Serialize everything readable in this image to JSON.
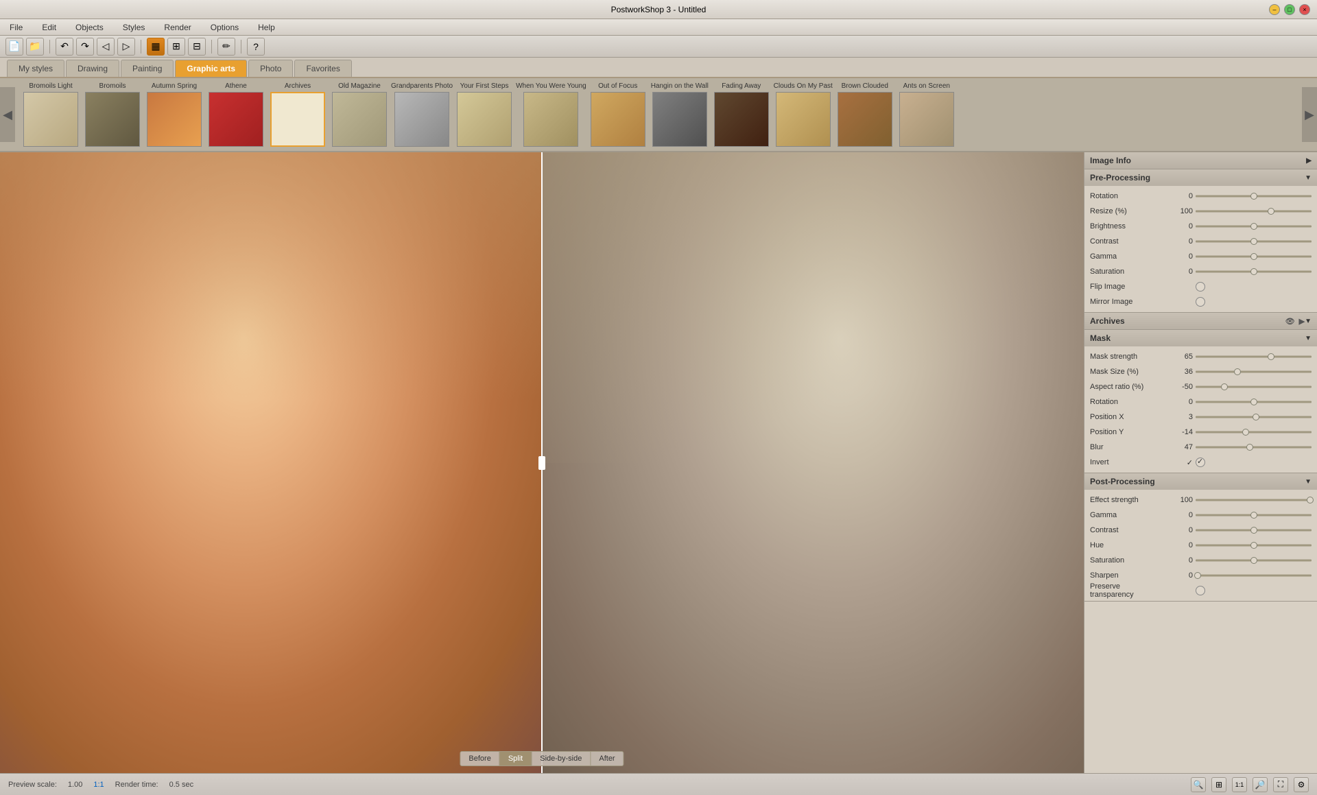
{
  "titlebar": {
    "title": "PostworkShop 3 - Untitled"
  },
  "menubar": {
    "items": [
      "File",
      "Edit",
      "Objects",
      "Styles",
      "Render",
      "Options",
      "Help"
    ]
  },
  "toolbar": {
    "buttons": [
      "new",
      "open",
      "undo",
      "redo",
      "history-back",
      "history-forward",
      "select-rect",
      "select-multi",
      "style1",
      "style2",
      "style3",
      "brush",
      "help"
    ]
  },
  "style_tabs": {
    "items": [
      "My styles",
      "Drawing",
      "Painting",
      "Graphic arts",
      "Photo",
      "Favorites"
    ],
    "active": "Graphic arts"
  },
  "thumbnails": {
    "items": [
      {
        "label": "Bromoils Light",
        "style": "bromoils-light",
        "active": false
      },
      {
        "label": "Bromoils",
        "style": "bromoils",
        "active": false
      },
      {
        "label": "Autumn Spring",
        "style": "autumn",
        "active": false
      },
      {
        "label": "Athene",
        "style": "athene",
        "active": false
      },
      {
        "label": "Archives",
        "style": "archives",
        "active": true
      },
      {
        "label": "Old Magazine",
        "style": "old-magazine",
        "active": false
      },
      {
        "label": "Grandparents Photo",
        "style": "grandparents",
        "active": false
      },
      {
        "label": "Your First Steps",
        "style": "first-steps",
        "active": false
      },
      {
        "label": "When You Were Young",
        "style": "when-young",
        "active": false
      },
      {
        "label": "Out of Focus",
        "style": "out-of-focus",
        "active": false
      },
      {
        "label": "Hangin on the Wall",
        "style": "hangin",
        "active": false
      },
      {
        "label": "Fading Away",
        "style": "fading",
        "active": false
      },
      {
        "label": "Clouds On My Past",
        "style": "clouds",
        "active": false
      },
      {
        "label": "Brown Clouded",
        "style": "brown",
        "active": false
      },
      {
        "label": "Ants on Screen",
        "style": "ants",
        "active": false
      }
    ]
  },
  "view_buttons": {
    "items": [
      "Before",
      "Split",
      "Side-by-side",
      "After"
    ],
    "active": "Split"
  },
  "panels": {
    "image_info": {
      "label": "Image Info",
      "collapsed": false
    },
    "pre_processing": {
      "label": "Pre-Processing",
      "collapsed": false,
      "params": [
        {
          "label": "Rotation",
          "value": "0",
          "percent": 50
        },
        {
          "label": "Resize (%)",
          "value": "100",
          "percent": 65
        },
        {
          "label": "Brightness",
          "value": "0",
          "percent": 50
        },
        {
          "label": "Contrast",
          "value": "0",
          "percent": 50
        },
        {
          "label": "Gamma",
          "value": "0",
          "percent": 50
        },
        {
          "label": "Saturation",
          "value": "0",
          "percent": 50
        },
        {
          "label": "Flip Image",
          "value": "",
          "type": "checkbox",
          "checked": false
        },
        {
          "label": "Mirror Image",
          "value": "",
          "type": "checkbox",
          "checked": false
        }
      ]
    },
    "archives": {
      "label": "Archives",
      "collapsed": false
    },
    "mask": {
      "label": "Mask",
      "collapsed": false,
      "params": [
        {
          "label": "Mask strength",
          "value": "65",
          "percent": 65
        },
        {
          "label": "Mask Size (%)",
          "value": "36",
          "percent": 36
        },
        {
          "label": "Aspect ratio (%)",
          "value": "-50",
          "percent": 25
        },
        {
          "label": "Rotation",
          "value": "0",
          "percent": 50
        },
        {
          "label": "Position X",
          "value": "3",
          "percent": 52
        },
        {
          "label": "Position Y",
          "value": "-14",
          "percent": 43
        },
        {
          "label": "Blur",
          "value": "47",
          "percent": 47
        },
        {
          "label": "Invert",
          "value": "✓",
          "type": "checkbox",
          "checked": true
        }
      ]
    },
    "post_processing": {
      "label": "Post-Processing",
      "collapsed": false,
      "params": [
        {
          "label": "Effect strength",
          "value": "100",
          "percent": 100
        },
        {
          "label": "Gamma",
          "value": "0",
          "percent": 50
        },
        {
          "label": "Contrast",
          "value": "0",
          "percent": 50
        },
        {
          "label": "Hue",
          "value": "0",
          "percent": 50
        },
        {
          "label": "Saturation",
          "value": "0",
          "percent": 50
        },
        {
          "label": "Sharpen",
          "value": "0",
          "percent": 2
        },
        {
          "label": "Preserve transparency",
          "value": "",
          "type": "checkbox",
          "checked": false
        }
      ]
    }
  },
  "statusbar": {
    "preview_label": "Preview scale:",
    "preview_value": "1.00",
    "ratio": "1:1",
    "render_label": "Render time:",
    "render_value": "0.5 sec"
  }
}
